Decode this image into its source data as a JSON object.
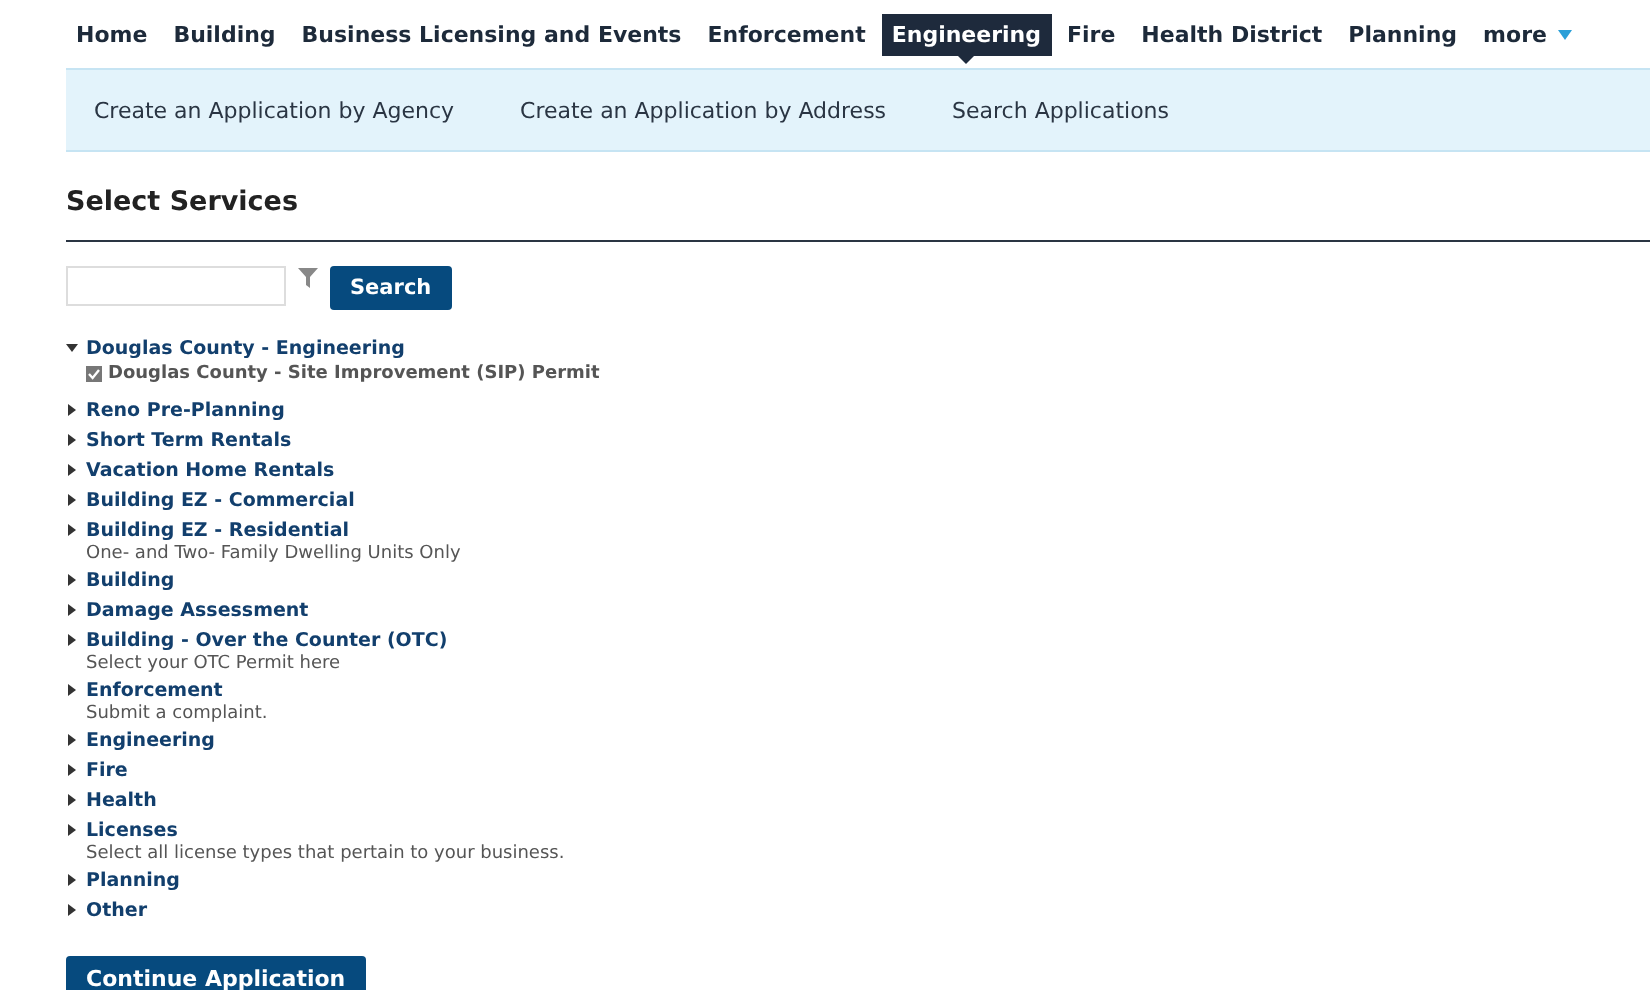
{
  "top_nav": [
    {
      "label": "Home",
      "selected": false
    },
    {
      "label": "Building",
      "selected": false
    },
    {
      "label": "Business Licensing and Events",
      "selected": false
    },
    {
      "label": "Enforcement",
      "selected": false
    },
    {
      "label": "Engineering",
      "selected": true
    },
    {
      "label": "Fire",
      "selected": false
    },
    {
      "label": "Health District",
      "selected": false
    },
    {
      "label": "Planning",
      "selected": false
    }
  ],
  "more": {
    "label": "more"
  },
  "sub_nav": [
    "Create an Application by Agency",
    "Create an Application by Address",
    "Search Applications"
  ],
  "heading": "Select Services",
  "search": {
    "button": "Search"
  },
  "tree": [
    {
      "label": "Douglas County - Engineering",
      "expanded": true,
      "children": [
        {
          "label": "Douglas County - Site Improvement (SIP) Permit",
          "checked": true
        }
      ]
    },
    {
      "label": "Reno Pre-Planning",
      "expanded": false
    },
    {
      "label": "Short Term Rentals",
      "expanded": false
    },
    {
      "label": "Vacation Home Rentals",
      "expanded": false
    },
    {
      "label": "Building EZ - Commercial",
      "expanded": false
    },
    {
      "label": "Building EZ - Residential",
      "expanded": false,
      "description": "One- and Two- Family Dwelling Units Only"
    },
    {
      "label": "Building",
      "expanded": false
    },
    {
      "label": "Damage Assessment",
      "expanded": false
    },
    {
      "label": "Building - Over the Counter (OTC)",
      "expanded": false,
      "description": "Select your OTC Permit here"
    },
    {
      "label": "Enforcement",
      "expanded": false,
      "description": "Submit a complaint."
    },
    {
      "label": "Engineering",
      "expanded": false
    },
    {
      "label": "Fire",
      "expanded": false
    },
    {
      "label": "Health",
      "expanded": false
    },
    {
      "label": "Licenses",
      "expanded": false,
      "description": "Select all license types that pertain to your business."
    },
    {
      "label": "Planning",
      "expanded": false
    },
    {
      "label": "Other",
      "expanded": false
    }
  ],
  "continue_button": "Continue Application"
}
